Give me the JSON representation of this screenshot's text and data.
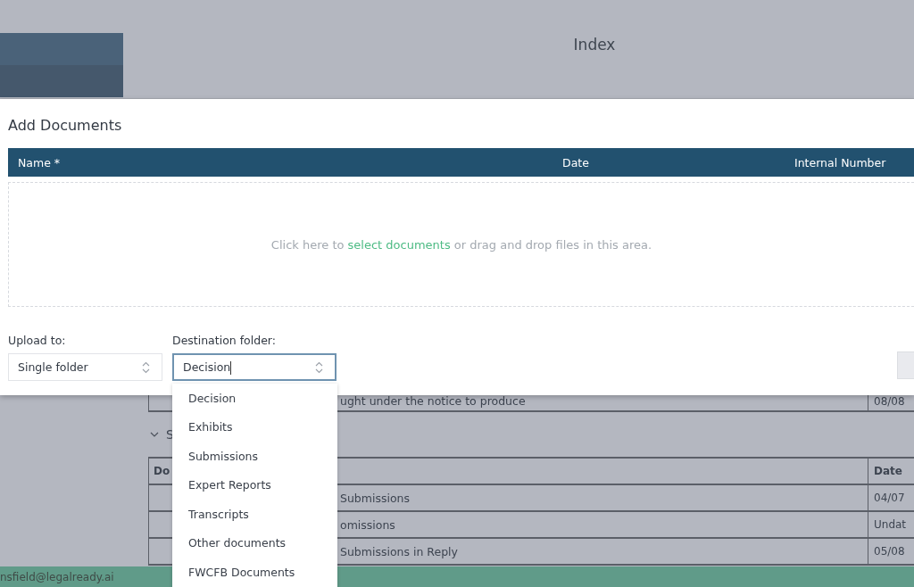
{
  "header": {
    "title": "Index"
  },
  "background_table_1": {
    "rows": [
      {
        "column_2": "ught under the notice to produce",
        "date": "08/08"
      }
    ]
  },
  "background_section": {
    "title": "S",
    "expanded": true
  },
  "background_table_2": {
    "columns": [
      "Do",
      "Date"
    ],
    "rows": [
      {
        "column_2": "Submissions",
        "date": "04/07"
      },
      {
        "column_2": "omissions",
        "date": "Undat"
      },
      {
        "column_2": "Submissions in Reply",
        "date": "05/08"
      }
    ]
  },
  "modal": {
    "title": "Add Documents",
    "columns": [
      "Name *",
      "Date",
      "Internal Number"
    ],
    "drop_zone": {
      "before": "Click here to ",
      "link": "select documents",
      "after": " or drag and drop files in this area."
    },
    "upload_to": {
      "label": "Upload to:",
      "value": "Single folder"
    },
    "destination": {
      "label": "Destination folder:",
      "value": "Decision",
      "options": [
        "Decision",
        "Exhibits",
        "Submissions",
        "Expert Reports",
        "Transcripts",
        "Other documents",
        "FWCFB Documents"
      ]
    }
  },
  "status_bar": {
    "user": "nsfield@legalready.ai"
  }
}
